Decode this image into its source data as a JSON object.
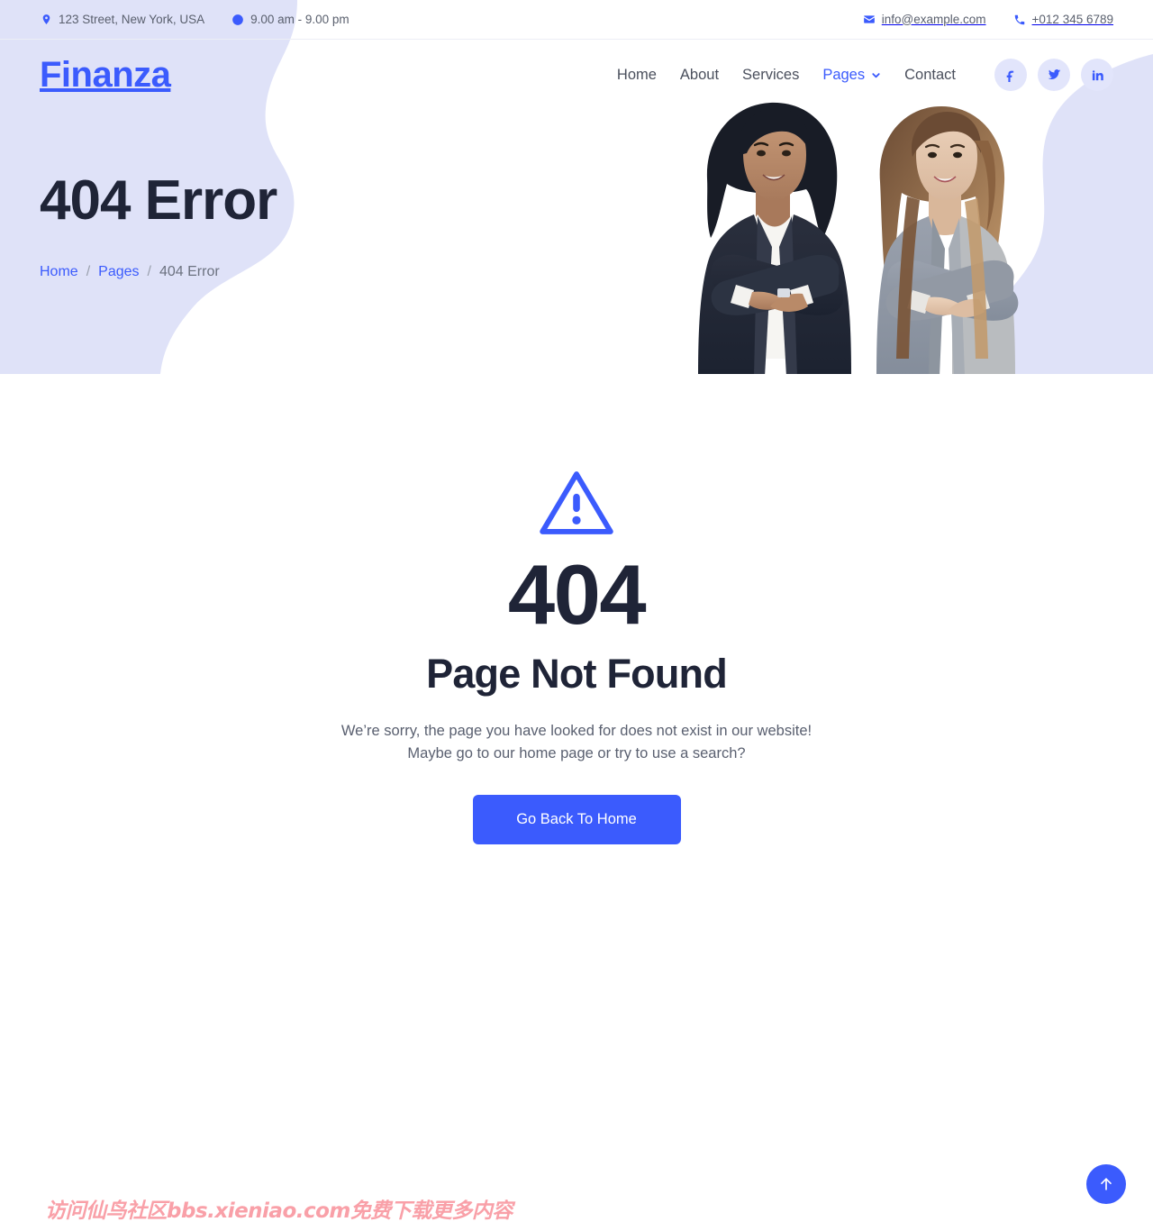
{
  "topbar": {
    "address": "123 Street, New York, USA",
    "hours": "9.00 am - 9.00 pm",
    "email": "info@example.com",
    "phone": "+012 345 6789",
    "icons": {
      "location": "location-pin-icon",
      "clock": "clock-icon",
      "mail": "envelope-icon",
      "phone": "phone-icon"
    }
  },
  "brand": {
    "name": "Finanza",
    "color": "#3b5bfd"
  },
  "nav": {
    "items": [
      {
        "label": "Home",
        "active": false,
        "has_dropdown": false
      },
      {
        "label": "About",
        "active": false,
        "has_dropdown": false
      },
      {
        "label": "Services",
        "active": false,
        "has_dropdown": false
      },
      {
        "label": "Pages",
        "active": true,
        "has_dropdown": true
      },
      {
        "label": "Contact",
        "active": false,
        "has_dropdown": false
      }
    ],
    "socials": [
      {
        "name": "facebook-icon",
        "label": "f"
      },
      {
        "name": "twitter-icon",
        "label": "t"
      },
      {
        "name": "linkedin-icon",
        "label": "in"
      }
    ]
  },
  "hero": {
    "title": "404 Error",
    "breadcrumb": [
      {
        "label": "Home",
        "link": true
      },
      {
        "label": "Pages",
        "link": true
      },
      {
        "label": "404 Error",
        "link": false
      }
    ],
    "separator": "/",
    "image_alt": "two-businesswomen-photo"
  },
  "error": {
    "warning_icon": "warning-triangle-icon",
    "code": "404",
    "heading": "Page Not Found",
    "description_line1": "We’re sorry, the page you have looked for does not exist in our website!",
    "description_line2": "Maybe go to our home page or try to use a search?",
    "button_label": "Go Back To Home"
  },
  "watermark": {
    "text": "访问仙鸟社区bbs.xieniao.com免费下载更多内容",
    "color": "#f9a0a8"
  },
  "back_to_top": {
    "icon": "arrow-up-icon"
  },
  "theme": {
    "accent": "#3b5bfd",
    "lavender": "#dfe2f8",
    "dark_text": "#1f2437",
    "body_text": "#5a6070"
  }
}
